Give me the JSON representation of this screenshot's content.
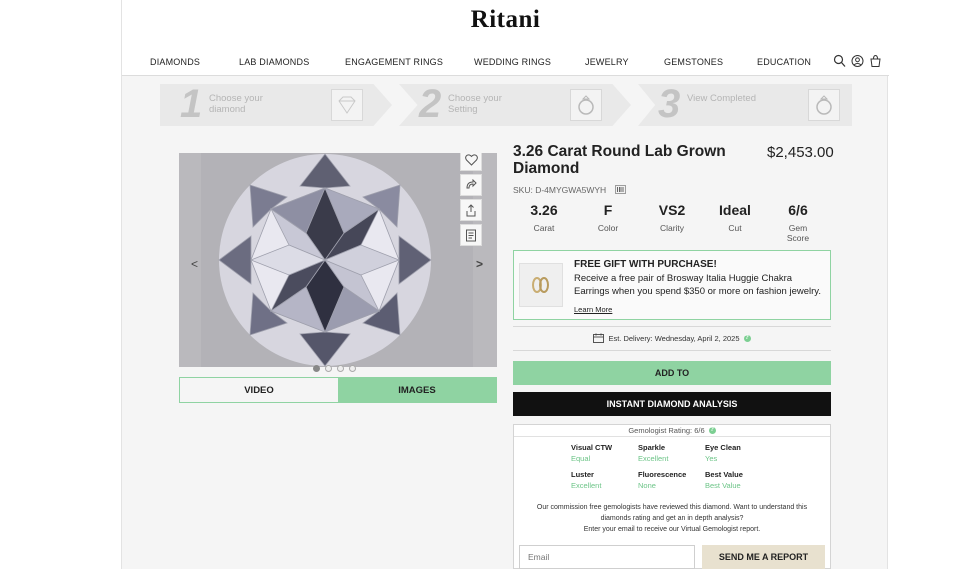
{
  "brand": {
    "logo": "Ritani"
  },
  "nav": {
    "items": [
      "DIAMONDS",
      "LAB DIAMONDS",
      "ENGAGEMENT RINGS",
      "WEDDING RINGS",
      "JEWELRY",
      "GEMSTONES",
      "EDUCATION"
    ],
    "icons": [
      "search-icon",
      "account-icon",
      "cart-icon"
    ]
  },
  "steps": [
    {
      "number": "1",
      "label": "Choose your diamond"
    },
    {
      "number": "2",
      "label": "Choose your Setting"
    },
    {
      "number": "3",
      "label": "View Completed"
    }
  ],
  "gallery": {
    "tabs": [
      "VIDEO",
      "IMAGES"
    ],
    "active_tab": "IMAGES",
    "dots": 4,
    "active_dot": 1
  },
  "product": {
    "title": "3.26 Carat Round Lab Grown Diamond",
    "price": "$2,453.00",
    "sku": "SKU: D-4MYGWA5WYH",
    "specs": [
      {
        "value": "3.26",
        "label": "Carat"
      },
      {
        "value": "F",
        "label": "Color"
      },
      {
        "value": "VS2",
        "label": "Clarity"
      },
      {
        "value": "Ideal",
        "label": "Cut"
      },
      {
        "value": "6/6",
        "label": "Gem Score"
      }
    ]
  },
  "promo": {
    "heading": "FREE GIFT WITH PURCHASE!",
    "body": "Receive a free pair of Brosway Italia Huggie Chakra Earrings when you spend $350 or more on fashion jewelry.",
    "link": "Learn More"
  },
  "delivery": {
    "text": "Est. Delivery: Wednesday, April 2, 2025"
  },
  "buttons": {
    "add": "ADD TO",
    "analysis": "INSTANT DIAMOND ANALYSIS",
    "send": "SEND ME A REPORT"
  },
  "gemologist": {
    "rating": "Gemologist Rating: 6/6",
    "attributes": [
      {
        "name": "Visual CTW",
        "value": "Equal"
      },
      {
        "name": "Sparkle",
        "value": "Excellent"
      },
      {
        "name": "Eye Clean",
        "value": "Yes"
      },
      {
        "name": "Luster",
        "value": "Excellent"
      },
      {
        "name": "Fluorescence",
        "value": "None"
      },
      {
        "name": "Best Value",
        "value": "Best Value"
      }
    ],
    "description_1": "Our commission free gemologists have reviewed this diamond. Want to understand this diamonds rating and get an in depth analysis?",
    "description_2": "Enter your email to receive our Virtual Gemologist report.",
    "email_placeholder": "Email"
  },
  "colors": {
    "accent_green": "#8fd3a2",
    "value_green": "#6cc487",
    "dark": "#111111",
    "report_button": "#e8e1cf"
  }
}
